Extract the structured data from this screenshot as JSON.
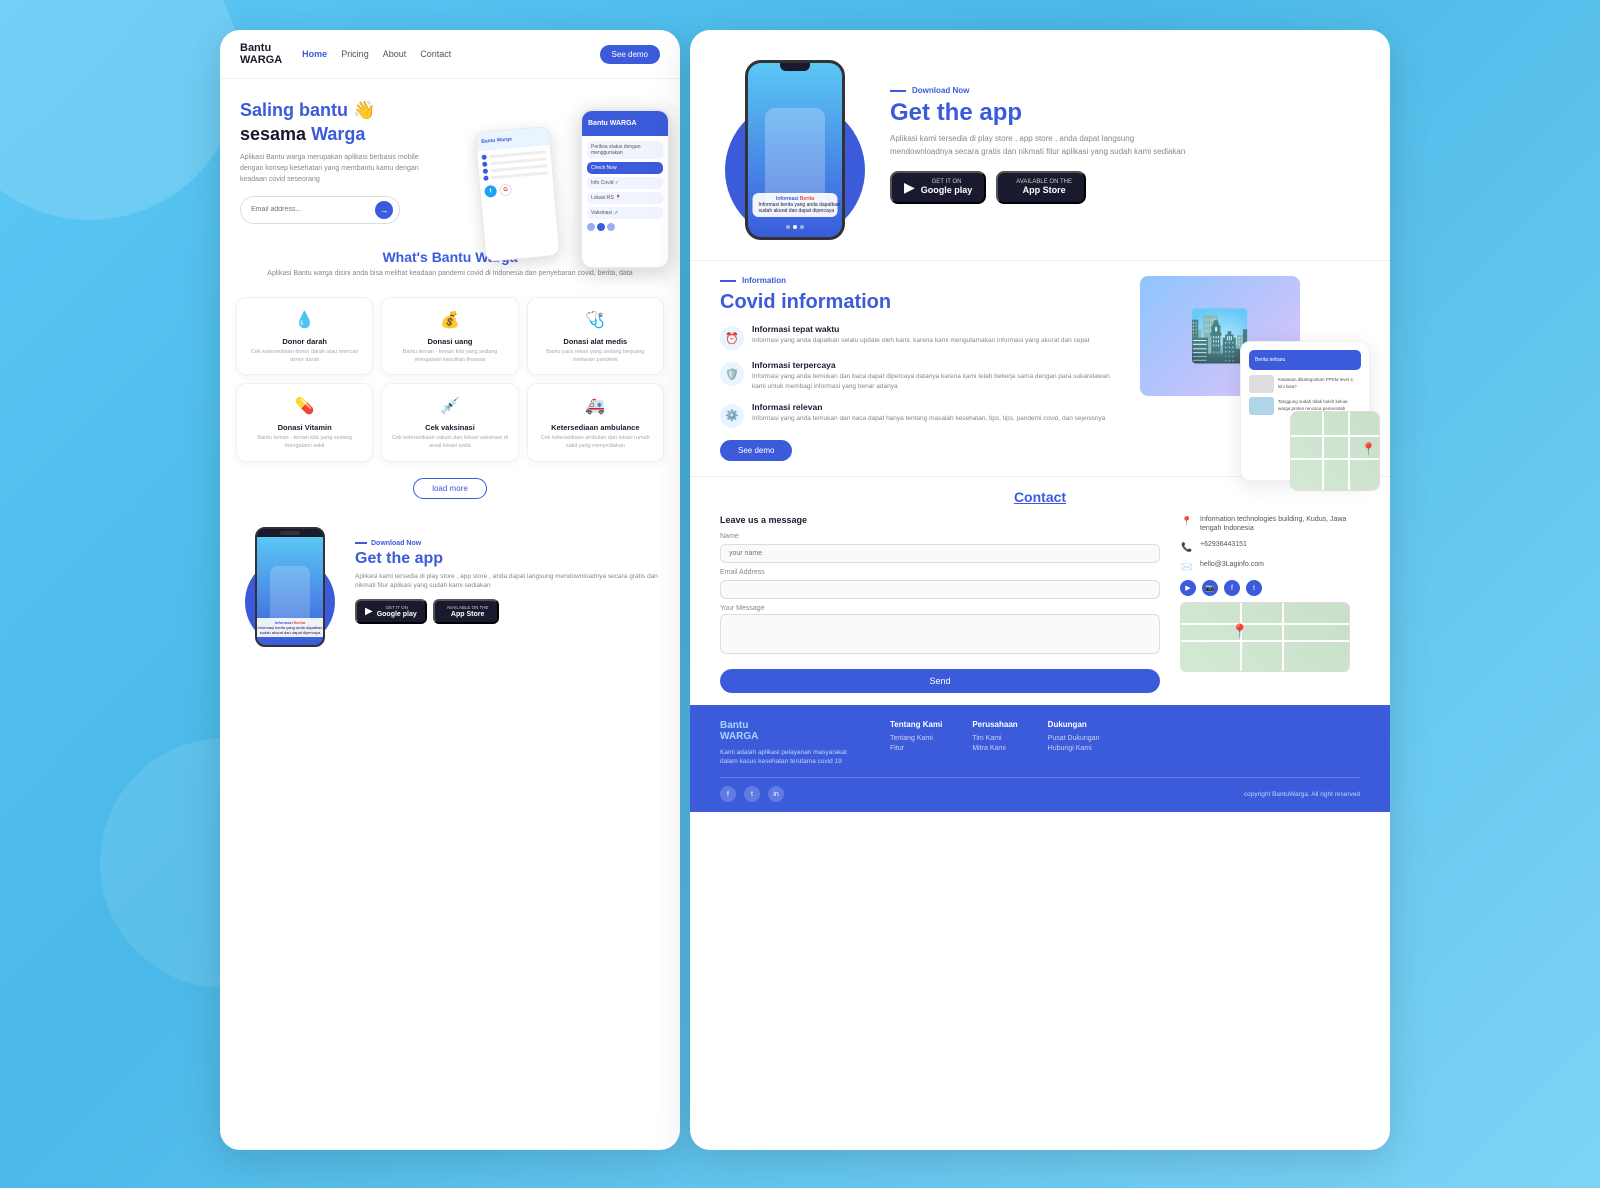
{
  "app": {
    "name": "BantuWARGA",
    "logo_line1": "Bantu",
    "logo_line2": "WARGA"
  },
  "navbar": {
    "links": [
      "Home",
      "Pricing",
      "About",
      "Contact"
    ],
    "active_link": "Home",
    "cta_label": "See demo"
  },
  "hero": {
    "headline_1": "Saling bantu 👋",
    "headline_2": "sesama ",
    "headline_highlight": "Warga",
    "description": "Aplikasi Bantu warga merupakan aplikasi berbasis mobile dengan konsep kesehatan yang membantu kamu dengan keadaan covid seseorang",
    "email_placeholder": "Email address...",
    "arrow_icon": "→"
  },
  "whats_section": {
    "title_normal": "What's ",
    "title_highlight": "Bantu Warga",
    "description": "Aplikasi Bantu warga disini anda bisa melihat keadaan pandemi covid di Indonesia dan penyebaran covid, berita, data"
  },
  "features": [
    {
      "icon": "💧",
      "title": "Donor darah",
      "description": "Cek ketersediaan donor darah atau mencari donor darah"
    },
    {
      "icon": "💰",
      "title": "Donasi uang",
      "description": "Bantu teman - teman kita yang sedang mengalami kesulitan finansia"
    },
    {
      "icon": "🩺",
      "title": "Donasi alat medis",
      "description": "Bantu para rekan yang sedang berjuang melawan pandemi"
    },
    {
      "icon": "💊",
      "title": "Donasi Vitamin",
      "description": "Bantu teman - teman kita yang sedang mengalami sakit"
    },
    {
      "icon": "💉",
      "title": "Cek vaksinasi",
      "description": "Cek ketersediaan vaksin dan lokasi vaksinasi di areal lokasi anda"
    },
    {
      "icon": "🚑",
      "title": "Ketersediaan ambulance",
      "description": "Cek ketersediaan ambulan dan lokasi rumah sakit yang menyediakan"
    }
  ],
  "load_more_label": "load more",
  "get_app": {
    "download_label": "Download Now",
    "headline_normal": "Get ",
    "headline_highlight": "the app",
    "description": "Aplikasi kami tersedia di play store , app store , anda dapat langsung mendownloadnya secara gratis dan nikmati fitur aplikasi yang sudah kami sediakan",
    "google_play": {
      "sub": "GET IT ON",
      "main": "Google play"
    },
    "app_store": {
      "sub": "AVAILABLE ON THE",
      "main": "App Store"
    },
    "phone_badge_title": "Informasi",
    "phone_badge_highlight": "Berita",
    "phone_badge_text": "Informasi berita yang anda dapatkan sudah akurat dan dapat dipercaya"
  },
  "covid_info": {
    "section_label": "Information",
    "headline_normal": "Covid ",
    "headline_highlight": "information",
    "features": [
      {
        "icon": "⏰",
        "title": "Informasi tepat waktu",
        "description": "Informasi yang anda dapatkan selalu update oleh kami, karena kami mengutamakan informasi yang akurat dan cepat"
      },
      {
        "icon": "🛡️",
        "title": "Informasi terpercaya",
        "description": "Informasi yang anda temukan dan baca dapat dipercaya datanya karena kami telah bekerja sama dengan para sukarelawan kami untuk membagi informasi yang benar adanya"
      },
      {
        "icon": "⚙️",
        "title": "Informasi relevan",
        "description": "Informasi yang anda temukan dan baca dapat hanya tentang masalah kesehatan, tips, tips, pandemi covid, dan sejenisnya"
      }
    ],
    "cta_label": "See demo",
    "news_header": "Berita terbaru"
  },
  "contact": {
    "title": "Contact",
    "form_title": "Leave us a message",
    "name_label": "Name",
    "name_placeholder": "your name",
    "email_label": "Email Address",
    "email_placeholder": "",
    "message_label": "Your Message",
    "send_label": "Send",
    "address": "Information technologies building, Kudus, Jawa tengah Indonesia",
    "phone": "+62936443151",
    "email": "hello@3Laginfo.com",
    "phone_icon": "📞",
    "email_icon": "✉️",
    "location_icon": "📍"
  },
  "footer": {
    "brand_name_1": "Bantu",
    "brand_name_2": "WARGA",
    "brand_description": "Kami adalah aplikasi pelayanan masyarakat dalam kasus kesehatan terutama covid 19",
    "columns": [
      {
        "title": "Tentang Kami",
        "links": [
          "Tentang Kami",
          "Fitur"
        ]
      },
      {
        "title": "Perusahaan",
        "links": [
          "Tim Kami",
          "Mitra Kami"
        ]
      },
      {
        "title": "Dukungan",
        "links": [
          "Pusat Dukungan",
          "Hubungi Kami"
        ]
      }
    ],
    "copyright": "copyright BantuWarga. All right reserved",
    "social_icons": [
      "f",
      "t",
      "in"
    ]
  }
}
